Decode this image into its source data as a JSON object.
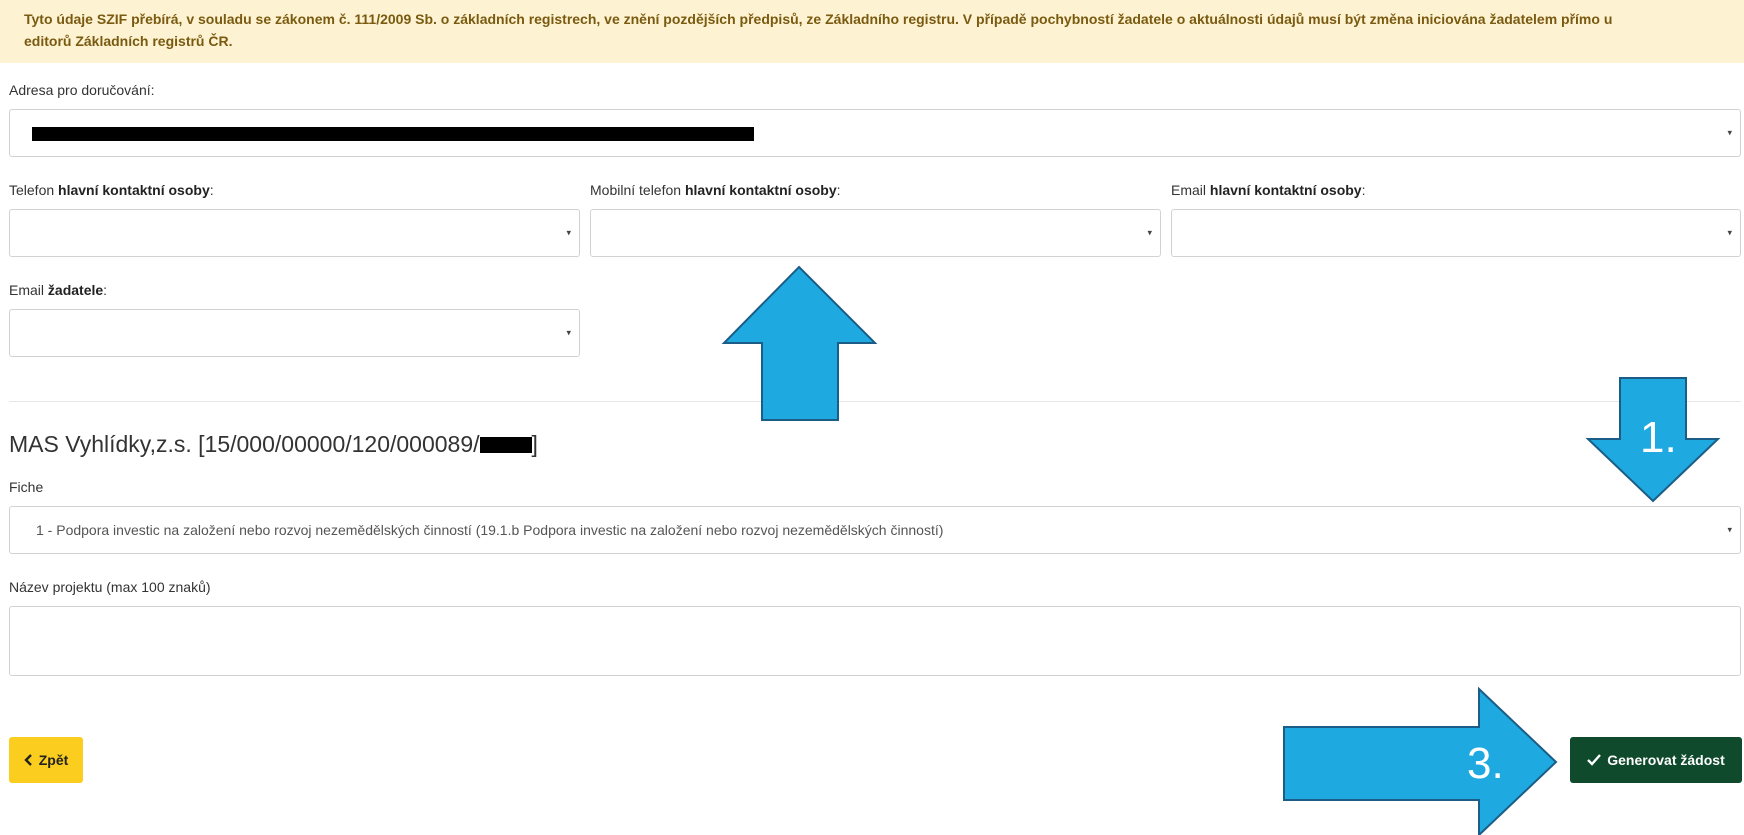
{
  "notice": {
    "line1": "Tyto údaje SZIF přebírá, v souladu se zákonem č. 111/2009 Sb. o základních registrech, ve znění pozdějších předpisů, ze Základního registru. V případě pochybností žadatele o aktuálnosti údajů musí být změna iniciována žadatelem přímo u",
    "line2": "editorů Základních registrů ČR."
  },
  "address": {
    "label": "Adresa pro doručování:"
  },
  "contacts": {
    "phone": {
      "prefix": "Telefon ",
      "bold": "hlavní kontaktní osoby",
      "suffix": ":"
    },
    "mobile": {
      "prefix": "Mobilní telefon ",
      "bold": "hlavní kontaktní osoby",
      "suffix": ":"
    },
    "email_contact": {
      "prefix": "Email ",
      "bold": "hlavní kontaktní osoby",
      "suffix": ":"
    },
    "email_applicant": {
      "prefix": "Email ",
      "bold": "žadatele",
      "suffix": ":"
    }
  },
  "mas": {
    "title_start": "MAS Vyhlídky,z.s. [15/000/00000/120/000089/",
    "title_end": "]"
  },
  "fiche": {
    "label": "Fiche",
    "selected": "1 - Podpora investic na založení nebo rozvoj nezemědělských činností (19.1.b Podpora investic na založení nebo rozvoj nezemědělských činností)"
  },
  "project_name": {
    "label": "Název projektu (max 100 znaků)",
    "value": ""
  },
  "buttons": {
    "back": "Zpět",
    "generate": "Generovat žádost"
  },
  "annotations": {
    "step1": "1.",
    "step3": "3."
  },
  "colors": {
    "notice_bg": "#fdf3d2",
    "back_btn": "#fbcd1e",
    "generate_btn": "#0f4a2d",
    "arrow": "#1eaae0"
  },
  "icons": {
    "back": "chevron-left-icon",
    "generate": "checkmark-icon",
    "dropdown": "caret-down-icon"
  },
  "caret": "▾"
}
